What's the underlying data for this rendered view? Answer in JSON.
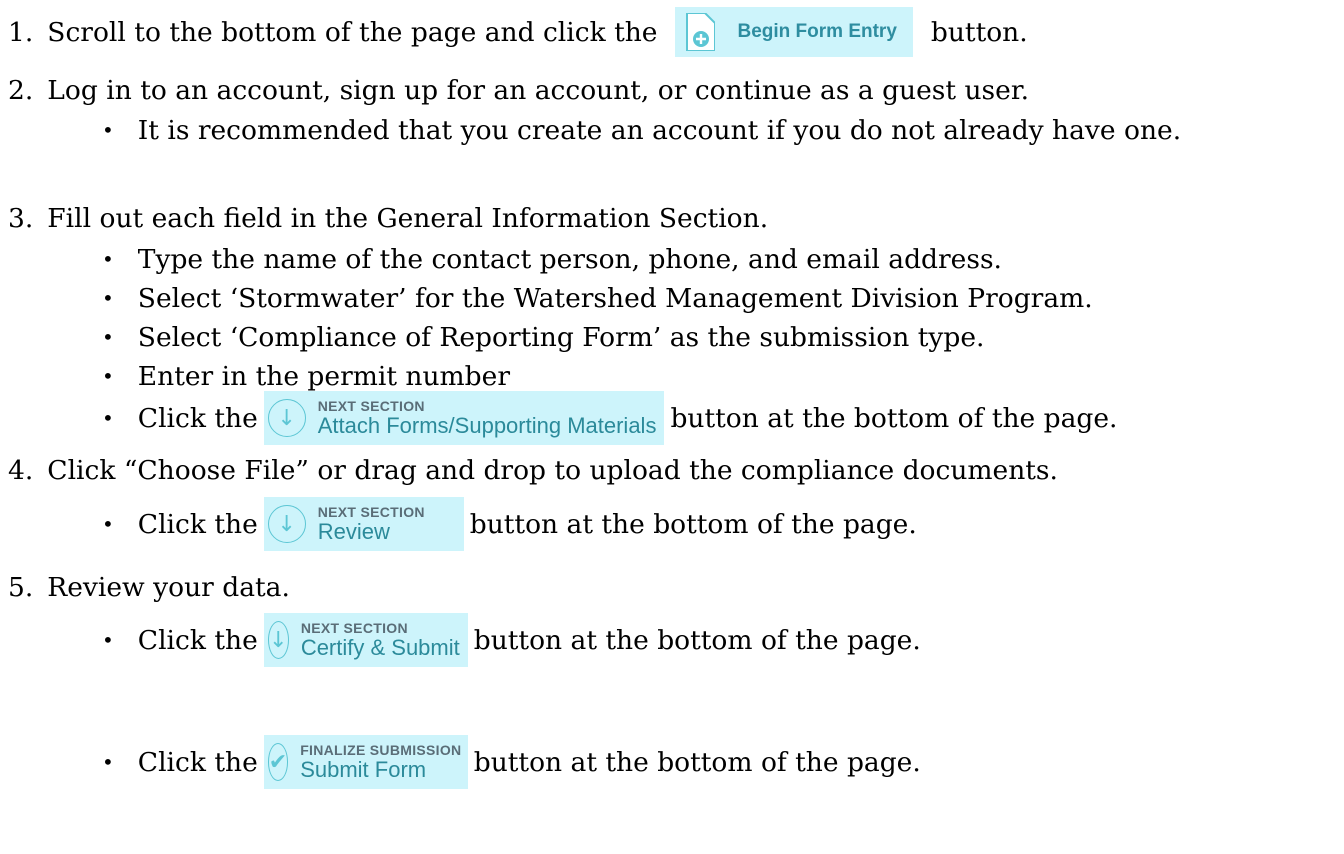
{
  "steps": [
    {
      "num": "1.",
      "before": "Scroll to the bottom of the page and click the",
      "button_label": "Begin Form Entry",
      "after": "button."
    },
    {
      "num": "2.",
      "text": "Log in to an account, sign up for an account, or continue as a guest user."
    },
    {
      "num": "3.",
      "text": "Fill out each field in the General Information Section."
    },
    {
      "num": "4.",
      "text": "Click “Choose File” or drag and drop to upload the compliance documents."
    },
    {
      "num": "5.",
      "text": "Review your data."
    }
  ],
  "bullets": {
    "step2": [
      "It is recommended that you create an account if you do not already have one."
    ],
    "step3": [
      "Type the name of the contact person, phone, and email address.",
      "Select ‘Stormwater’ for the Watershed Management Division Program.",
      "Select ‘Compliance of Reporting Form’ as the submission type.",
      "Enter in the permit number"
    ]
  },
  "click_lines": {
    "prefix": "Click the",
    "suffix": "button at the bottom of the page.",
    "attach": {
      "eyebrow": "NEXT SECTION",
      "label": "Attach Forms/Supporting Materials"
    },
    "review": {
      "eyebrow": "NEXT SECTION",
      "label": "Review"
    },
    "certify": {
      "eyebrow": "NEXT SECTION",
      "label": "Certify & Submit"
    },
    "submit": {
      "eyebrow": "FINALIZE SUBMISSION",
      "label": "Submit Form"
    }
  },
  "icons": {
    "begin": "document-add-icon",
    "next": "arrow-down-icon",
    "finalize": "checkmark-icon"
  },
  "colors": {
    "chip_bg": "#cdf4fb",
    "accent": "#5cc6d4",
    "label_teal": "#2b8a9a"
  }
}
